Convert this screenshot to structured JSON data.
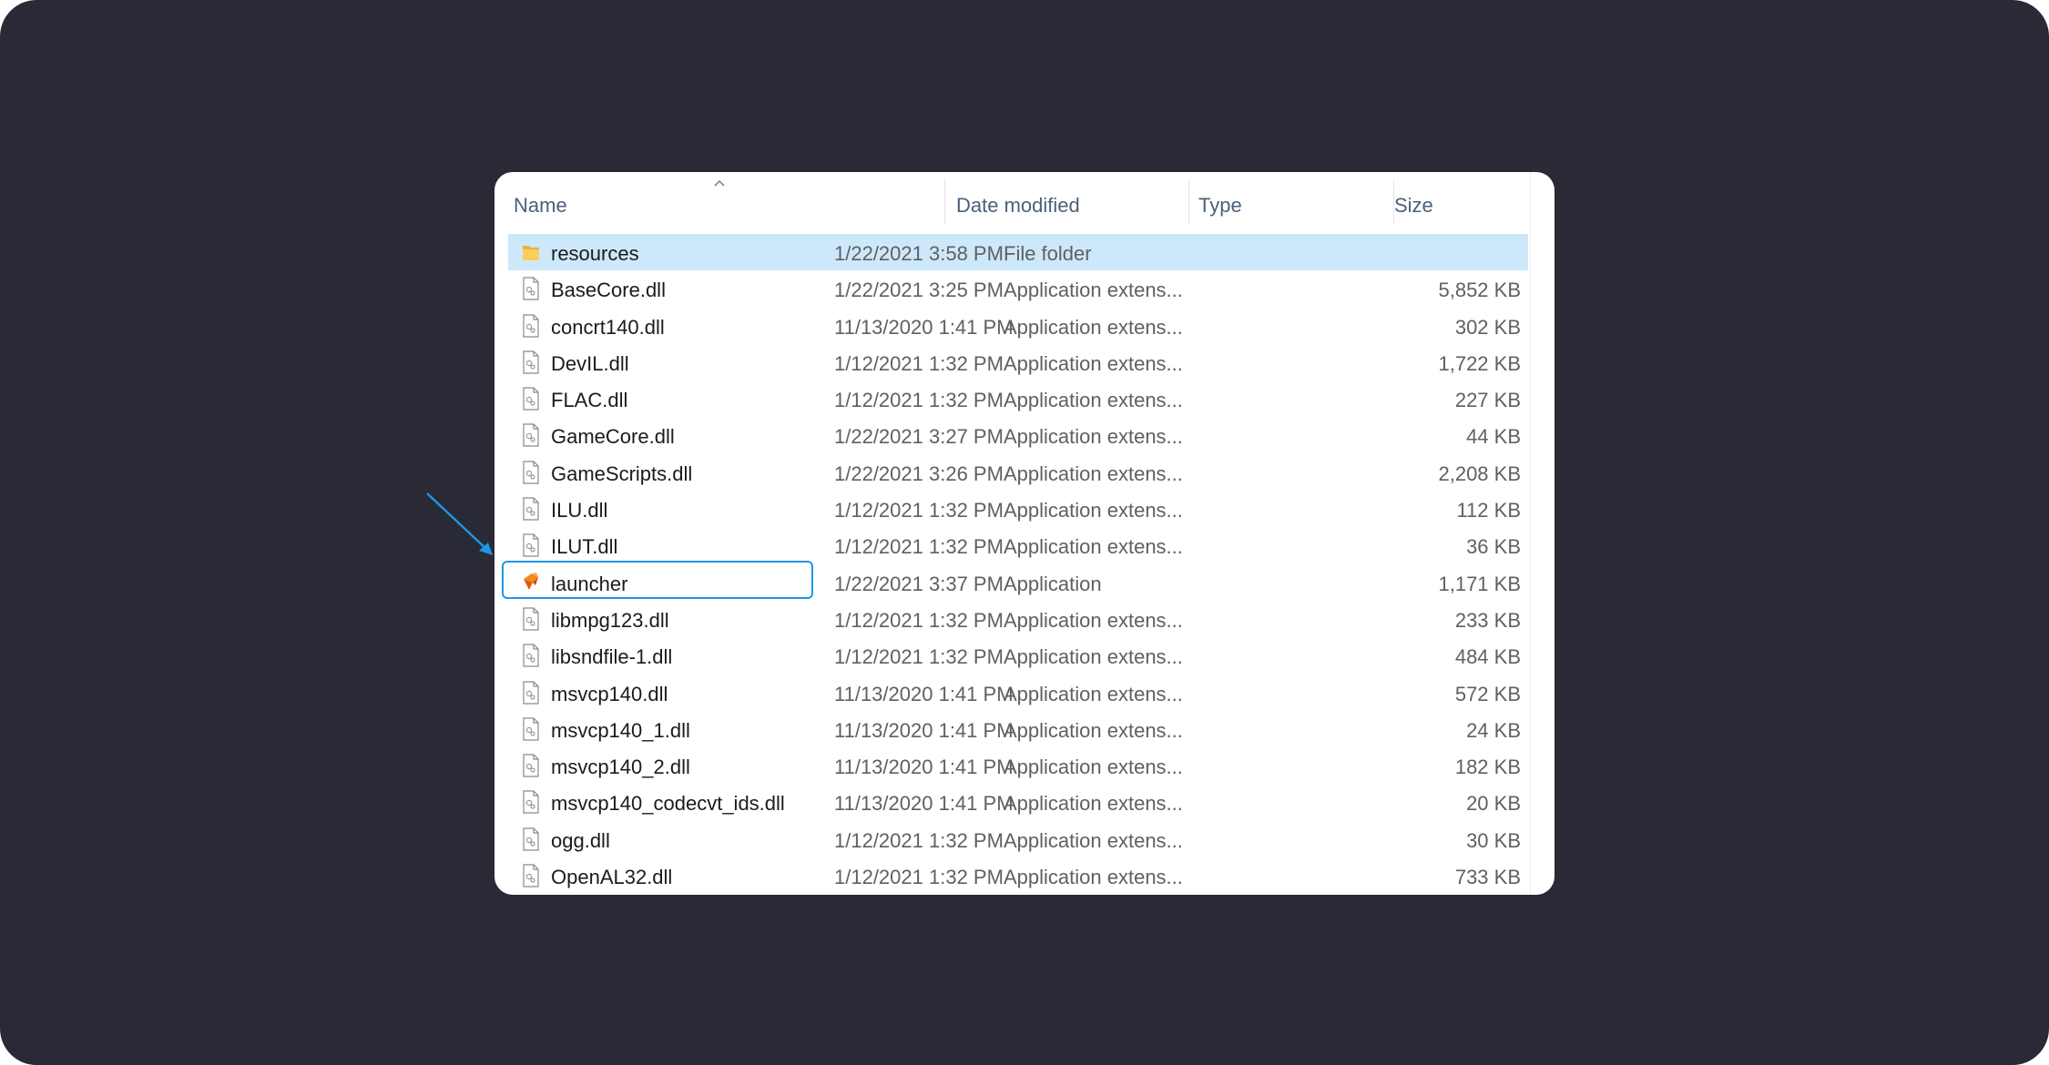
{
  "columns": {
    "name": "Name",
    "date": "Date modified",
    "type": "Type",
    "size": "Size"
  },
  "sort": {
    "column": "Name",
    "direction": "ascending",
    "icon": "chevron-up-icon"
  },
  "files": [
    {
      "name": "resources",
      "date": "1/22/2021 3:58 PM",
      "type": "File folder",
      "size": "",
      "icon": "folder-icon",
      "selected": true
    },
    {
      "name": "BaseCore.dll",
      "date": "1/22/2021 3:25 PM",
      "type": "Application extens...",
      "size": "5,852 KB",
      "icon": "dll-file-icon"
    },
    {
      "name": "concrt140.dll",
      "date": "11/13/2020 1:41 PM",
      "type": "Application extens...",
      "size": "302 KB",
      "icon": "dll-file-icon"
    },
    {
      "name": "DevIL.dll",
      "date": "1/12/2021 1:32 PM",
      "type": "Application extens...",
      "size": "1,722 KB",
      "icon": "dll-file-icon"
    },
    {
      "name": "FLAC.dll",
      "date": "1/12/2021 1:32 PM",
      "type": "Application extens...",
      "size": "227 KB",
      "icon": "dll-file-icon"
    },
    {
      "name": "GameCore.dll",
      "date": "1/22/2021 3:27 PM",
      "type": "Application extens...",
      "size": "44 KB",
      "icon": "dll-file-icon"
    },
    {
      "name": "GameScripts.dll",
      "date": "1/22/2021 3:26 PM",
      "type": "Application extens...",
      "size": "2,208 KB",
      "icon": "dll-file-icon"
    },
    {
      "name": "ILU.dll",
      "date": "1/12/2021 1:32 PM",
      "type": "Application extens...",
      "size": "112 KB",
      "icon": "dll-file-icon"
    },
    {
      "name": "ILUT.dll",
      "date": "1/12/2021 1:32 PM",
      "type": "Application extens...",
      "size": "36 KB",
      "icon": "dll-file-icon"
    },
    {
      "name": "launcher",
      "date": "1/22/2021 3:37 PM",
      "type": "Application",
      "size": "1,171 KB",
      "icon": "launcher-app-icon",
      "highlighted": true
    },
    {
      "name": "libmpg123.dll",
      "date": "1/12/2021 1:32 PM",
      "type": "Application extens...",
      "size": "233 KB",
      "icon": "dll-file-icon"
    },
    {
      "name": "libsndfile-1.dll",
      "date": "1/12/2021 1:32 PM",
      "type": "Application extens...",
      "size": "484 KB",
      "icon": "dll-file-icon"
    },
    {
      "name": "msvcp140.dll",
      "date": "11/13/2020 1:41 PM",
      "type": "Application extens...",
      "size": "572 KB",
      "icon": "dll-file-icon"
    },
    {
      "name": "msvcp140_1.dll",
      "date": "11/13/2020 1:41 PM",
      "type": "Application extens...",
      "size": "24 KB",
      "icon": "dll-file-icon"
    },
    {
      "name": "msvcp140_2.dll",
      "date": "11/13/2020 1:41 PM",
      "type": "Application extens...",
      "size": "182 KB",
      "icon": "dll-file-icon"
    },
    {
      "name": "msvcp140_codecvt_ids.dll",
      "date": "11/13/2020 1:41 PM",
      "type": "Application extens...",
      "size": "20 KB",
      "icon": "dll-file-icon"
    },
    {
      "name": "ogg.dll",
      "date": "1/12/2021 1:32 PM",
      "type": "Application extens...",
      "size": "30 KB",
      "icon": "dll-file-icon"
    },
    {
      "name": "OpenAL32.dll",
      "date": "1/12/2021 1:32 PM",
      "type": "Application extens...",
      "size": "733 KB",
      "icon": "dll-file-icon"
    }
  ],
  "annotation": {
    "arrow_icon": "pointer-arrow-icon",
    "color": "#1f96e8"
  },
  "colors": {
    "backdrop": "#292a35",
    "selection": "#cde8fb",
    "highlight": "#1f96e8",
    "header_text": "#4c607a"
  }
}
